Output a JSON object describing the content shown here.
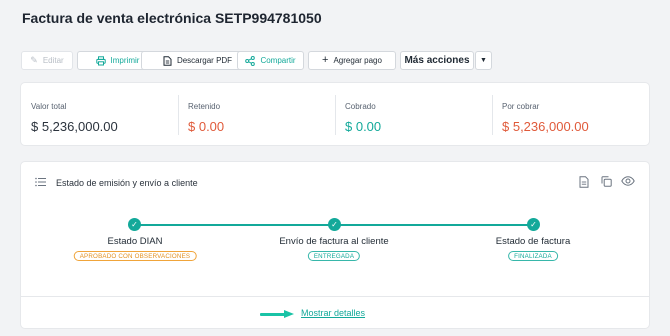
{
  "page": {
    "title": "Factura de venta electrónica SETP994781050"
  },
  "toolbar": {
    "edit_label": "Editar",
    "print_label": "Imprimir",
    "download_label": "Descargar PDF",
    "share_label": "Compartir",
    "payment_label": "Agregar pago",
    "more_label": "Más acciones"
  },
  "summary": {
    "items": [
      {
        "label": "Valor total",
        "value": "$ 5,236,000.00",
        "color": "#2b333d"
      },
      {
        "label": "Retenido",
        "value": "$ 0.00",
        "color": "#e05a3a"
      },
      {
        "label": "Cobrado",
        "value": "$ 0.00",
        "color": "#13a99a"
      },
      {
        "label": "Por cobrar",
        "value": "$ 5,236,000.00",
        "color": "#e05a3a"
      }
    ]
  },
  "status": {
    "header": "Estado de emisión y envío a cliente",
    "steps": [
      {
        "label": "Estado DIAN",
        "badge": "APROBADO CON OBSERVACIONES",
        "badge_color": "#f0a43a"
      },
      {
        "label": "Envío de factura al cliente",
        "badge": "ENTREGADA",
        "badge_color": "#13a99a"
      },
      {
        "label": "Estado de factura",
        "badge": "FINALIZADA",
        "badge_color": "#13a99a"
      }
    ],
    "details_link": "Mostrar detalles"
  },
  "icons": {
    "edit": "pencil-icon",
    "print": "printer-icon",
    "download": "document-icon",
    "share": "share-icon",
    "payment": "plus-icon",
    "more": "caret-down-icon",
    "list": "list-icon",
    "xml": "file-code-icon",
    "copy": "copy-icon",
    "view": "eye-icon"
  },
  "colors": {
    "accent": "#13a99a",
    "negative": "#e05a3a",
    "warning": "#f0a43a"
  }
}
